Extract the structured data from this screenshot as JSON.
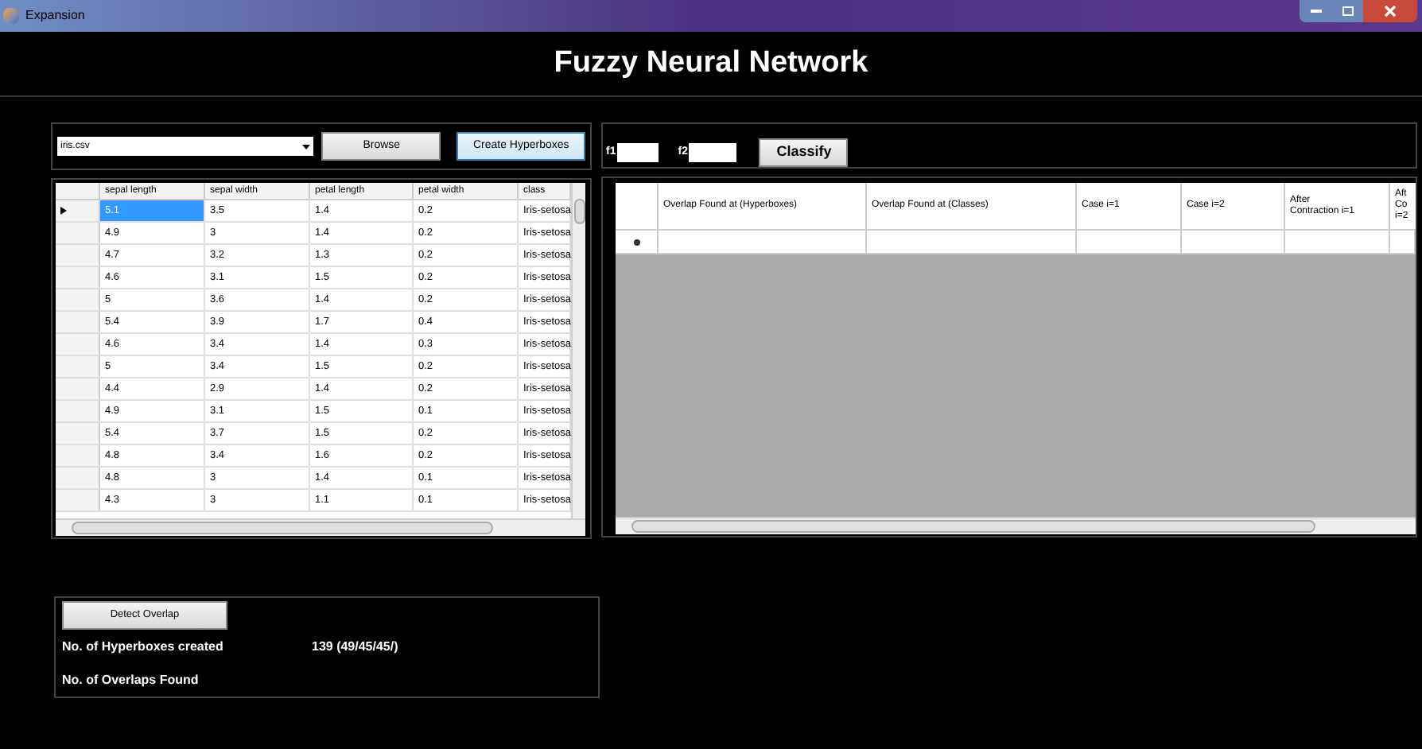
{
  "window": {
    "title": "Expansion"
  },
  "heading": "Fuzzy Neural Network",
  "file_picker": {
    "value": "iris.csv",
    "browse_button": "Browse",
    "create_button": "Create Hyperboxes"
  },
  "classify_panel": {
    "f1_label": "f1",
    "f2_label": "f2",
    "classify_button": "Classify"
  },
  "data_grid": {
    "columns": [
      "sepal length",
      "sepal width",
      "petal length",
      "petal width",
      "class"
    ],
    "rows": [
      {
        "current": true,
        "cells": [
          {
            "text": "5.1",
            "selected": true
          },
          {
            "text": "3.5",
            "selected": false
          },
          {
            "text": "1.4",
            "selected": false
          },
          {
            "text": "0.2",
            "selected": false
          },
          {
            "text": "Iris-setosa",
            "selected": false
          }
        ]
      },
      {
        "current": false,
        "cells": [
          {
            "text": "4.9",
            "selected": false
          },
          {
            "text": "3",
            "selected": false
          },
          {
            "text": "1.4",
            "selected": false
          },
          {
            "text": "0.2",
            "selected": false
          },
          {
            "text": "Iris-setosa",
            "selected": false
          }
        ]
      },
      {
        "current": false,
        "cells": [
          {
            "text": "4.7",
            "selected": false
          },
          {
            "text": "3.2",
            "selected": false
          },
          {
            "text": "1.3",
            "selected": false
          },
          {
            "text": "0.2",
            "selected": false
          },
          {
            "text": "Iris-setosa",
            "selected": false
          }
        ]
      },
      {
        "current": false,
        "cells": [
          {
            "text": "4.6",
            "selected": false
          },
          {
            "text": "3.1",
            "selected": false
          },
          {
            "text": "1.5",
            "selected": false
          },
          {
            "text": "0.2",
            "selected": false
          },
          {
            "text": "Iris-setosa",
            "selected": false
          }
        ]
      },
      {
        "current": false,
        "cells": [
          {
            "text": "5",
            "selected": false
          },
          {
            "text": "3.6",
            "selected": false
          },
          {
            "text": "1.4",
            "selected": false
          },
          {
            "text": "0.2",
            "selected": false
          },
          {
            "text": "Iris-setosa",
            "selected": false
          }
        ]
      },
      {
        "current": false,
        "cells": [
          {
            "text": "5.4",
            "selected": false
          },
          {
            "text": "3.9",
            "selected": false
          },
          {
            "text": "1.7",
            "selected": false
          },
          {
            "text": "0.4",
            "selected": false
          },
          {
            "text": "Iris-setosa",
            "selected": false
          }
        ]
      },
      {
        "current": false,
        "cells": [
          {
            "text": "4.6",
            "selected": false
          },
          {
            "text": "3.4",
            "selected": false
          },
          {
            "text": "1.4",
            "selected": false
          },
          {
            "text": "0.3",
            "selected": false
          },
          {
            "text": "Iris-setosa",
            "selected": false
          }
        ]
      },
      {
        "current": false,
        "cells": [
          {
            "text": "5",
            "selected": false
          },
          {
            "text": "3.4",
            "selected": false
          },
          {
            "text": "1.5",
            "selected": false
          },
          {
            "text": "0.2",
            "selected": false
          },
          {
            "text": "Iris-setosa",
            "selected": false
          }
        ]
      },
      {
        "current": false,
        "cells": [
          {
            "text": "4.4",
            "selected": false
          },
          {
            "text": "2.9",
            "selected": false
          },
          {
            "text": "1.4",
            "selected": false
          },
          {
            "text": "0.2",
            "selected": false
          },
          {
            "text": "Iris-setosa",
            "selected": false
          }
        ]
      },
      {
        "current": false,
        "cells": [
          {
            "text": "4.9",
            "selected": false
          },
          {
            "text": "3.1",
            "selected": false
          },
          {
            "text": "1.5",
            "selected": false
          },
          {
            "text": "0.1",
            "selected": false
          },
          {
            "text": "Iris-setosa",
            "selected": false
          }
        ]
      },
      {
        "current": false,
        "cells": [
          {
            "text": "5.4",
            "selected": false
          },
          {
            "text": "3.7",
            "selected": false
          },
          {
            "text": "1.5",
            "selected": false
          },
          {
            "text": "0.2",
            "selected": false
          },
          {
            "text": "Iris-setosa",
            "selected": false
          }
        ]
      },
      {
        "current": false,
        "cells": [
          {
            "text": "4.8",
            "selected": false
          },
          {
            "text": "3.4",
            "selected": false
          },
          {
            "text": "1.6",
            "selected": false
          },
          {
            "text": "0.2",
            "selected": false
          },
          {
            "text": "Iris-setosa",
            "selected": false
          }
        ]
      },
      {
        "current": false,
        "cells": [
          {
            "text": "4.8",
            "selected": false
          },
          {
            "text": "3",
            "selected": false
          },
          {
            "text": "1.4",
            "selected": false
          },
          {
            "text": "0.1",
            "selected": false
          },
          {
            "text": "Iris-setosa",
            "selected": false
          }
        ]
      },
      {
        "current": false,
        "cells": [
          {
            "text": "4.3",
            "selected": false
          },
          {
            "text": "3",
            "selected": false
          },
          {
            "text": "1.1",
            "selected": false
          },
          {
            "text": "0.1",
            "selected": false
          },
          {
            "text": "Iris-setosa",
            "selected": false
          }
        ]
      }
    ]
  },
  "overlap_grid": {
    "columns": [
      "Overlap Found at (Hyperboxes)",
      "Overlap Found at (Classes)",
      "Case i=1",
      "Case i=2",
      "After Contraction i=1",
      "Aft Co i=2"
    ]
  },
  "overlap_panel": {
    "detect_button": "Detect Overlap",
    "hyperboxes_label": "No. of Hyperboxes created",
    "hyperboxes_value": "139 (49/45/45/)",
    "overlaps_label": "No. of Overlaps Found"
  }
}
